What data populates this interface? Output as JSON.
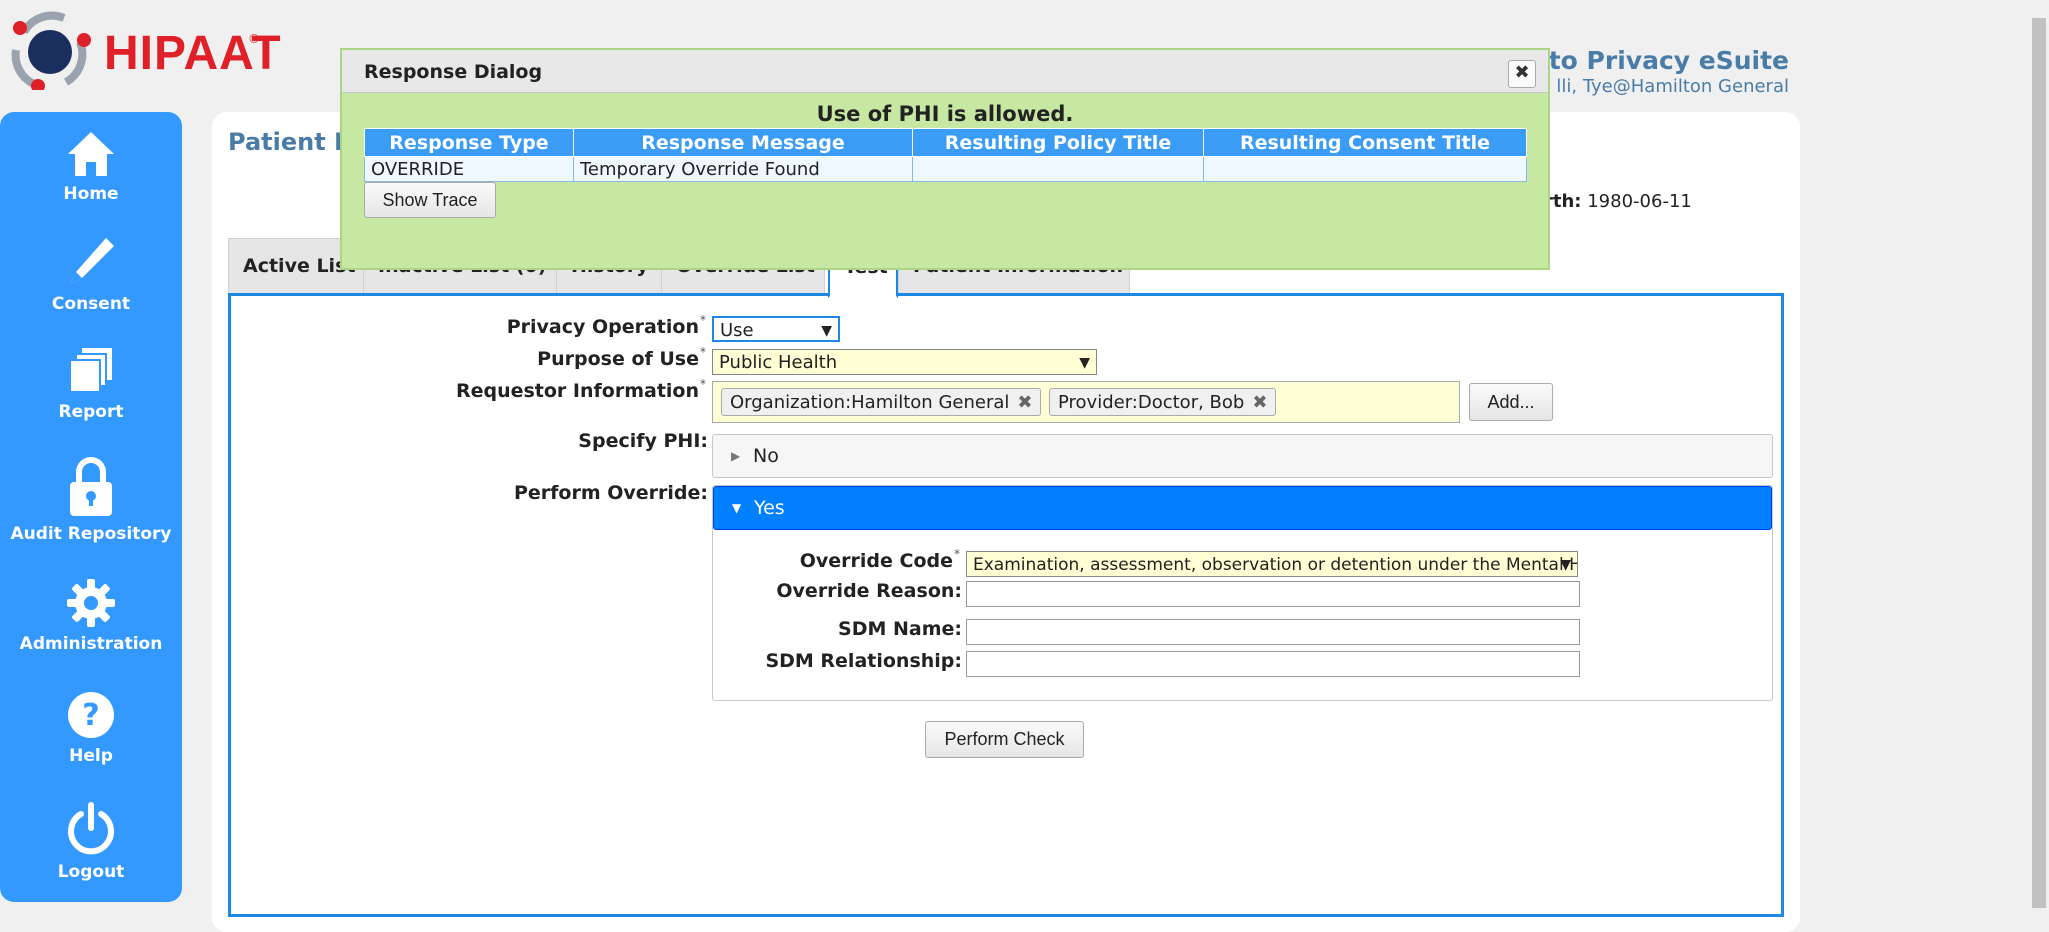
{
  "header": {
    "logo_text": "HIPAAT",
    "logo_reg": "®",
    "welcome_text": "e to Privacy eSuite",
    "user_text": "lli, Tye@Hamilton General"
  },
  "nav": {
    "items": [
      {
        "label": "Home",
        "icon": "home-icon"
      },
      {
        "label": "Consent",
        "icon": "pen-icon"
      },
      {
        "label": "Report",
        "icon": "report-icon"
      },
      {
        "label": "Audit Repository",
        "icon": "lock-icon"
      },
      {
        "label": "Administration",
        "icon": "gear-icon"
      },
      {
        "label": "Help",
        "icon": "help-icon"
      },
      {
        "label": "Logout",
        "icon": "power-icon"
      }
    ]
  },
  "page": {
    "title": "Patient P",
    "dob_label": "rth:",
    "dob_value": "1980-06-11"
  },
  "tabs": [
    {
      "label": "Active List"
    },
    {
      "label": "Inactive List (0)"
    },
    {
      "label": "History"
    },
    {
      "label": "Override List"
    },
    {
      "label": "Test"
    },
    {
      "label": "Patient Information"
    }
  ],
  "form": {
    "privacy_operation": {
      "label": "Privacy Operation",
      "value": "Use"
    },
    "purpose_of_use": {
      "label": "Purpose of Use",
      "value": "Public Health"
    },
    "requestor": {
      "label": "Requestor Information",
      "tags": [
        "Organization:Hamilton General",
        "Provider:Doctor, Bob"
      ],
      "add_label": "Add..."
    },
    "specify_phi": {
      "label": "Specify PHI:",
      "value": "No"
    },
    "perform_override": {
      "label": "Perform Override:",
      "value": "Yes"
    },
    "override_code": {
      "label": "Override Code",
      "value": "Examination, assessment, observation or detention under the Mental He"
    },
    "override_reason": {
      "label": "Override Reason:",
      "value": ""
    },
    "sdm_name": {
      "label": "SDM Name:",
      "value": ""
    },
    "sdm_relationship": {
      "label": "SDM Relationship:",
      "value": ""
    },
    "required_mark": "*",
    "perform_check_label": "Perform Check"
  },
  "dialog": {
    "title": "Response Dialog",
    "close_glyph": "✖",
    "message": "Use of PHI is allowed.",
    "columns": [
      "Response Type",
      "Response Message",
      "Resulting Policy Title",
      "Resulting Consent Title"
    ],
    "rows": [
      [
        "OVERRIDE",
        "Temporary Override Found",
        "",
        ""
      ]
    ],
    "show_trace_label": "Show Trace"
  },
  "colors": {
    "nav_bg": "#3399ff",
    "accent": "#1e88e5",
    "dialog_bg": "#c6e8a3",
    "logo_red": "#e02028"
  }
}
